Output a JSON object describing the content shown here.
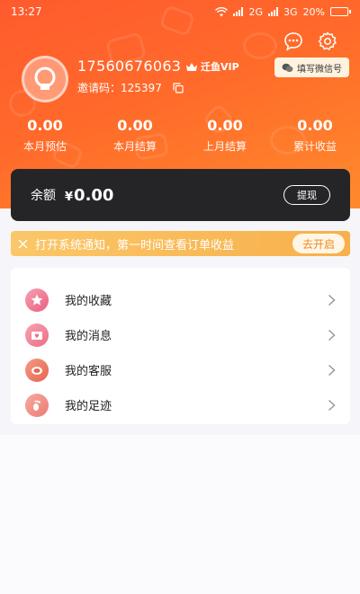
{
  "status_bar": {
    "time": "13:27",
    "network_1": "2G",
    "network_2": "3G",
    "battery": "20%",
    "battery_level": 0.2
  },
  "profile": {
    "phone": "17560676063",
    "vip_label": "迁鱼VIP",
    "invite_label": "邀请码：",
    "invite_code": "125397"
  },
  "wechat_button": {
    "label": "填写微信号"
  },
  "stats": [
    {
      "value": "0.00",
      "label": "本月预估"
    },
    {
      "value": "0.00",
      "label": "本月结算"
    },
    {
      "value": "0.00",
      "label": "上月结算"
    },
    {
      "value": "0.00",
      "label": "累计收益"
    }
  ],
  "balance": {
    "label": "余额",
    "currency": "¥",
    "amount": "0.00",
    "withdraw_label": "提现"
  },
  "notice": {
    "text": "打开系统通知，第一时间查看订单收益",
    "button_label": "去开启"
  },
  "menu": [
    {
      "label": "我的收藏",
      "icon": "star-icon"
    },
    {
      "label": "我的消息",
      "icon": "envelope-heart-icon"
    },
    {
      "label": "我的客服",
      "icon": "customer-service-icon"
    },
    {
      "label": "我的足迹",
      "icon": "footprint-icon"
    }
  ],
  "colors": {
    "header_start": "#ff5a2e",
    "header_end": "#ff8a2c",
    "balance_card": "#252527",
    "notice_bg": "#f7b04c",
    "accent": "#f08a1e"
  }
}
